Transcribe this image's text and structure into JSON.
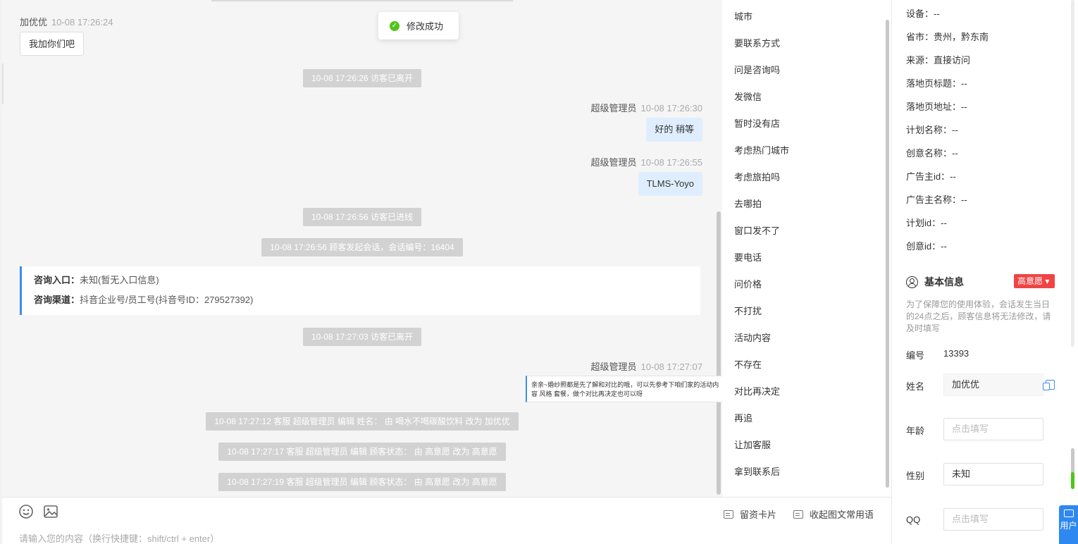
{
  "toast": {
    "text": "修改成功",
    "icon": "check-circle-icon",
    "color": "#52c41a"
  },
  "chat": {
    "msg1": {
      "sender": "加优优",
      "time": "10-08 17:26:24",
      "text": "我加你们吧"
    },
    "sys1": "10-08 17:26:26 访客已离开",
    "msg2": {
      "sender": "超级管理员",
      "time": "10-08 17:26:30",
      "text": "好的 稍等"
    },
    "msg3": {
      "sender": "超级管理员",
      "time": "10-08 17:26:55",
      "text": "TLMS-Yoyo"
    },
    "sys2": "10-08 17:26:56 访客已进线",
    "sys3": "10-08 17:26:56 顾客发起会话，会话编号：16404",
    "info_card": {
      "entry_label": "咨询入口：",
      "entry_value": "未知(暂无入口信息)",
      "channel_label": "咨询渠道：",
      "channel_value": "抖音企业号/员工号(抖音号ID：279527392)"
    },
    "sys4": "10-08 17:27:03 访客已离开",
    "msg4": {
      "sender": "超级管理员",
      "time": "10-08 17:27:07",
      "text": "亲亲~婚纱照都是先了解和对比的哦，可以先参考下咱们家的活动内容 风格 套餐，做个对比再决定也可以呀"
    },
    "sys5": "10-08 17:27:12 客服 超级管理员 编辑 姓名： 由 喝水不喝碳酸饮料 改为 加优优",
    "sys6": "10-08 17:27:17 客服 超级管理员 编辑 顾客状态： 由 高意愿 改为 高意愿",
    "sys7": "10-08 17:27:19 客服 超级管理员 编辑 顾客状态： 由 高意愿 改为 高意愿"
  },
  "input": {
    "placeholder": "请输入您的内容（换行快捷键：shift/ctrl + enter）",
    "emoji_icon": "smile-icon",
    "image_icon": "image-icon",
    "card_label": "留资卡片",
    "collapse_label": "收起图文常用语"
  },
  "phrases": [
    "城市",
    "要联系方式",
    "问是咨询吗",
    "发微信",
    "暂时没有店",
    "考虑热门城市",
    "考虑旅拍吗",
    "去哪拍",
    "窗口发不了",
    "要电话",
    "问价格",
    "不打扰",
    "活动内容",
    "不存在",
    "对比再决定",
    "再追",
    "让加客服",
    "拿到联系后"
  ],
  "customer": {
    "fields": [
      "设备：--",
      "省市：贵州，黔东南",
      "来源：直接访问",
      "落地页标题：--",
      "落地页地址：--",
      "计划名称：--",
      "创意名称：--",
      "广告主id：--",
      "广告主名称：--",
      "计划id：--",
      "创意id：--"
    ],
    "basic_title": "基本信息",
    "intent_badge": "高意愿",
    "intent_color": "#f04444",
    "notice": "为了保障您的使用体验，会话发生当日的24点之后，顾客信息将无法修改，请及时填写",
    "id_label": "编号",
    "id_value": "13393",
    "name_label": "姓名",
    "name_value": "加优优",
    "age_label": "年龄",
    "age_placeholder": "点击填写",
    "gender_label": "性别",
    "gender_value": "未知",
    "qq_label": "QQ",
    "qq_placeholder": "点击填写",
    "float_button": "用户"
  },
  "accent_color": "#3b8cf0"
}
